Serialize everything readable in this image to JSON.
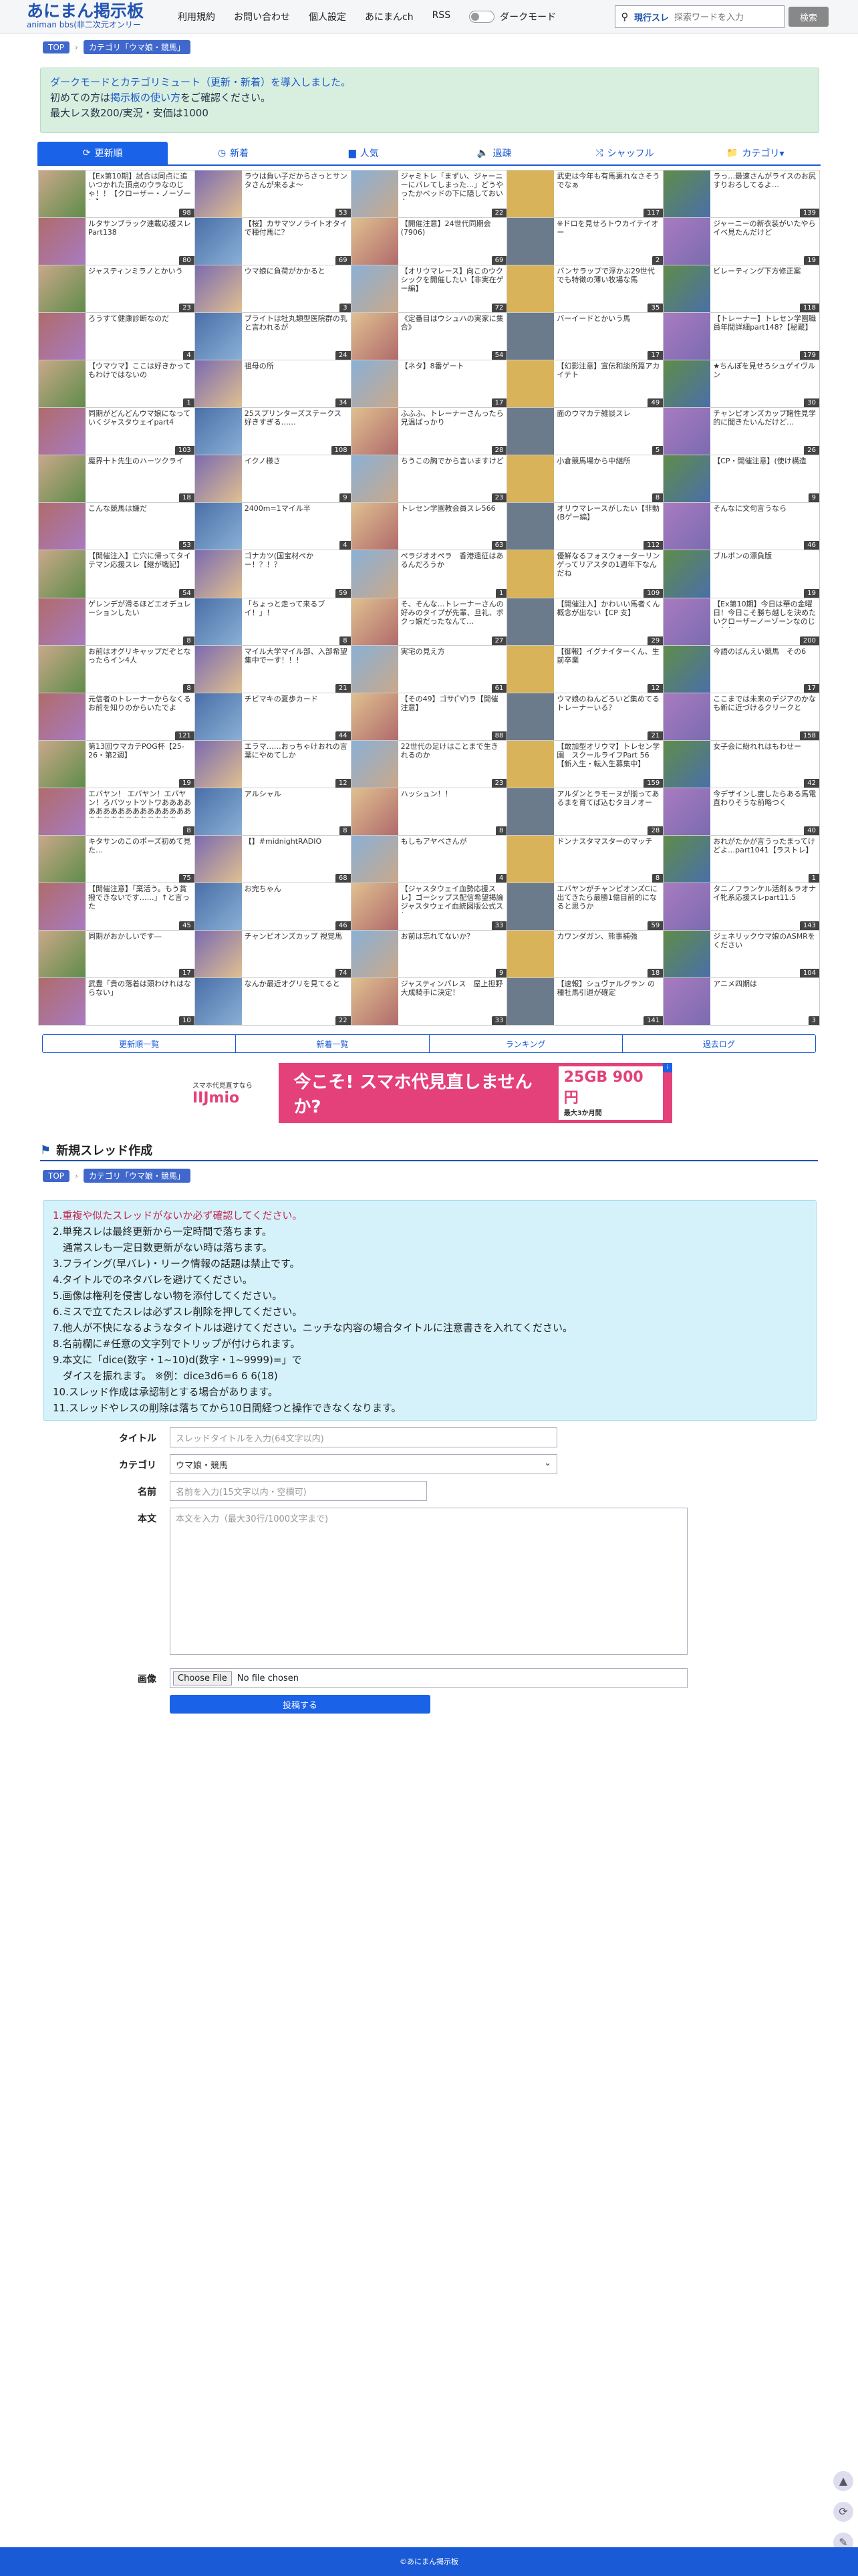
{
  "header": {
    "logo_main": "あにまん掲示板",
    "logo_sub": "animan bbs(非二次元オンリー",
    "nav": [
      "利用規約",
      "お問い合わせ",
      "個人設定",
      "あにまんch",
      "RSS"
    ],
    "dark_mode_label": "ダークモード",
    "search_kind": "現行スレ",
    "search_placeholder": "探索ワードを入力",
    "search_button": "検索"
  },
  "breadcrumb": {
    "top": "TOP",
    "category": "カテゴリ「ウマ娘・競馬」"
  },
  "notice": {
    "line1": "ダークモードとカテゴリミュート（更新・新着）を導入しました。",
    "line2_pre": "初めての方は",
    "line2_link": "掲示板の使い方",
    "line2_post": "をご確認ください。",
    "line3": "最大レス数200/実況・安価は1000"
  },
  "tabs": [
    "更新順",
    "新着",
    "人気",
    "過疎",
    "シャッフル",
    "カテゴリ▾"
  ],
  "threads": [
    {
      "title": "【Ex第10期】試合は同点に追いつかれた頂点のウラなのじゃ！！【クローザー・ノーゾーン】",
      "count": "98"
    },
    {
      "title": "ラウは負い子だからさっとサンタさんが来るよ〜",
      "count": "53"
    },
    {
      "title": "ジャミトレ「まずい、ジャーニーにバレてしまった…」どうやったかベッドの下に隠しておいた",
      "count": "22"
    },
    {
      "title": "武史は今年も有馬裏れなさそうでなぁ",
      "count": "117"
    },
    {
      "title": "ラっ…最速さんがライスのお尻すりおろしてるよ…",
      "count": "139"
    },
    {
      "title": "ルタサンブラック連載応援スレ Part138",
      "count": "80"
    },
    {
      "title": "【桜】カサマツノライトオタイで種付馬に？",
      "count": "69"
    },
    {
      "title": "【開催注意】24世代同期会(7906)",
      "count": "69"
    },
    {
      "title": "※ドロを見せろトウカイテイオー",
      "count": "2"
    },
    {
      "title": "ジャーニーの新衣装がいたやらイベ見たんだけど",
      "count": "19"
    },
    {
      "title": "ジャスティンミラノとかいう",
      "count": "23"
    },
    {
      "title": "ウマ娘に負荷がかかると",
      "count": "3"
    },
    {
      "title": "【オリウマレース】向このウクシックを開催したい【非実在ゲー編】",
      "count": "72"
    },
    {
      "title": "バンサラップで浮かぶ29世代でも特徴の薄い牧場な馬",
      "count": "35"
    },
    {
      "title": "ビレーティング下方修正案",
      "count": "118"
    },
    {
      "title": "ろうすて健康診断なのだ",
      "count": "4"
    },
    {
      "title": "ブライトは牡丸類型医院群の乳と言われるが",
      "count": "24"
    },
    {
      "title": "《定番目はウシュハの実家に集合》",
      "count": "54"
    },
    {
      "title": "バーイードとかいう馬",
      "count": "17"
    },
    {
      "title": "【トレーナー】トレセン学園職員年間詳細part148?【秘蔵】",
      "count": "179"
    },
    {
      "title": "【ウマウマ】ここは好きかってもわけではないの",
      "count": "1"
    },
    {
      "title": "祖母の所",
      "count": "34"
    },
    {
      "title": "【ネタ】8番ゲート",
      "count": "17"
    },
    {
      "title": "【幻影注意】宣伝和談所篇アカイテト",
      "count": "49"
    },
    {
      "title": "★ちんぽを見せろシュゲイヴルン",
      "count": "30"
    },
    {
      "title": "同期がどんどんウマ娘になっていくジャスタウェイpart4",
      "count": "103"
    },
    {
      "title": "25スプリンターズステークス好きすぎる……",
      "count": "108"
    },
    {
      "title": "ふふふ、トレーナーさんったら兄温ばっかり",
      "count": "28"
    },
    {
      "title": "面のウマカテ雑談スレ",
      "count": "5"
    },
    {
      "title": "チャンピオンズカップ賭性見学的に聞きたいんだけど…",
      "count": "26"
    },
    {
      "title": "魔界十ト先生のハーツクライ",
      "count": "18"
    },
    {
      "title": "イクノ様さ",
      "count": "9"
    },
    {
      "title": "ちうこの胸でから言いますけど",
      "count": "23"
    },
    {
      "title": "小倉競馬場から中継所",
      "count": "8"
    },
    {
      "title": "【CP・開催注意】(使け構造",
      "count": "9"
    },
    {
      "title": "こんな競馬は嫌だ",
      "count": "53"
    },
    {
      "title": "2400m=1マイル半",
      "count": "4"
    },
    {
      "title": "トレセン学園教会員スレ566",
      "count": "63"
    },
    {
      "title": "オリウマレースがしたい【非動(Bゲー編】",
      "count": "112"
    },
    {
      "title": "そんなに文句言うなら",
      "count": "46"
    },
    {
      "title": "【開催注入】亡穴に帰ってタイテマン応援スレ【継が戦記】",
      "count": "54"
    },
    {
      "title": "ゴナカツ(国宝材ぺかー！？！？",
      "count": "59"
    },
    {
      "title": "ペラジオオペラ　香港遠征はあるんだろうか",
      "count": "1"
    },
    {
      "title": "優鮮なるフォスウォーターリンゲってリアスタの1週年下なんだね",
      "count": "109"
    },
    {
      "title": "ブルボンの漂負版",
      "count": "19"
    },
    {
      "title": "ゲレンデが滑るほどエオデュレーションしたい",
      "count": "8"
    },
    {
      "title": "「ちょっと走って来るブイ！」！",
      "count": "8"
    },
    {
      "title": "そ、そんな…トレーナーさんの好みのタイプが先輩、旦礼、ボクっ娘だったなんて…",
      "count": "27"
    },
    {
      "title": "【開催注入】かわいい馬者くん概念が出ない【CP 支】",
      "count": "29"
    },
    {
      "title": "【Ex第10期】今日は華の金曜日！今日こそ勝ち越しを決めたいクローザーノーゾーンなのじゃ！！",
      "count": "200"
    },
    {
      "title": "お前はオグリキャップだぞとなったらイン4人",
      "count": "8"
    },
    {
      "title": "マイル大学マイル部、入部希望集中で一す！！！",
      "count": "21"
    },
    {
      "title": "実宅の見え方",
      "count": "61"
    },
    {
      "title": "【御報】イグナイターくん、生前卒業",
      "count": "12"
    },
    {
      "title": "今語のばんえい競馬　その6",
      "count": "17"
    },
    {
      "title": "元信者のトレーナーからなくるお前を知りのからいたでよ",
      "count": "121"
    },
    {
      "title": "チビマキの夏歩カード",
      "count": "44"
    },
    {
      "title": "【その49】ゴサ( ゚∀゚)ラ【開催注意】",
      "count": "88"
    },
    {
      "title": "ウマ娘のねんどろいど集めてるトレーナーいる？",
      "count": "21"
    },
    {
      "title": "ここまでは未来のデジアのかなも新に近づけるクリークと",
      "count": "158"
    },
    {
      "title": "第13回ウマカテPOG杯【25-26・第2週】",
      "count": "19"
    },
    {
      "title": "エラマ……おっちゃけおれの言葉にやめてしか",
      "count": "12"
    },
    {
      "title": "22世代の足けはことまで生きれるのか",
      "count": "23"
    },
    {
      "title": "【敢加型オリウマ】トレセン学園　スクールライフPart 56【新入生・転入生募集中】",
      "count": "159"
    },
    {
      "title": "女子会に紛れれはもわせー",
      "count": "42"
    },
    {
      "title": "エバヤン！ エバヤン！エバヤン！ろバツットツトワあああああああああああああああああああああああああああああああ！！！",
      "count": "8"
    },
    {
      "title": "アルシャル",
      "count": "8"
    },
    {
      "title": "ハッシュン！！",
      "count": "8"
    },
    {
      "title": "アルダンとラモーヌが揃ってあるまを育てば込むタヨノオー",
      "count": "28"
    },
    {
      "title": "今デザインし度したらある馬電直わりそうな前略つく",
      "count": "40"
    },
    {
      "title": "キタサンのこのポーズ初めて見た…",
      "count": "75"
    },
    {
      "title": "【】#midnightRADIO",
      "count": "68"
    },
    {
      "title": "もしもアヤベさんが",
      "count": "4"
    },
    {
      "title": "ドンナスタマスターのマッチ",
      "count": "8"
    },
    {
      "title": "おれがたかが言うったまってけどよ…part1041【ラストレ】",
      "count": "1"
    },
    {
      "title": "【開催注意】「棄活う。もう賞撥できないです……」↑と言った",
      "count": "45"
    },
    {
      "title": "お完ちゃん",
      "count": "46"
    },
    {
      "title": "【ジャスタウェイ血勢応援スレ】ゴーシップス配信希望掲論ジャスタウェイ血統図版公式スレ",
      "count": "33"
    },
    {
      "title": "エバヤンがチャンピオンズCに出てきたら最勝1億目前的になると思うか",
      "count": "59"
    },
    {
      "title": "タニノフランケル活剤＆ラオナイ牝系応援スレpart11.5",
      "count": "143"
    },
    {
      "title": "同期がおかしいです―",
      "count": "17"
    },
    {
      "title": "チャンピオンズカップ 視覚馬",
      "count": "74"
    },
    {
      "title": "お前は忘れてないか？",
      "count": "9"
    },
    {
      "title": "カワンダガン、熊事補強",
      "count": "18"
    },
    {
      "title": "ジェネリックウマ娘のASMRをください",
      "count": "104"
    },
    {
      "title": "武豊「貴の落着は頭わけれはならない」",
      "count": "10"
    },
    {
      "title": "なんか最近オグリを見てると",
      "count": "22"
    },
    {
      "title": "ジャスティンパレス　屋上担野大成騎手に決定！",
      "count": "33"
    },
    {
      "title": "【速報】シュヴァルグラン の種牡馬引退が確定",
      "count": "141"
    },
    {
      "title": "アニメ四期は",
      "count": "3"
    }
  ],
  "bottom_nav": [
    "更新順一覧",
    "新着一覧",
    "ランキング",
    "過去ログ"
  ],
  "ad": {
    "small": "スマホ代見直すなら",
    "brand": "IIJmio",
    "headline": "今こそ! スマホ代見直しませんか?",
    "offer": "25GB 900円",
    "offer_note": "最大3か月間"
  },
  "new_thread": {
    "heading": "新規スレッド作成"
  },
  "rules": [
    "1.重複や似たスレッドがないか必ず確認してください。",
    "2.単発スレは最終更新から一定時間で落ちます。",
    "　通常スレも一定日数更新がない時は落ちます。",
    "3.フライング(早バレ)・リーク情報の話題は禁止です。",
    "4.タイトルでのネタバレを避けてください。",
    "5.画像は権利を侵害しない物を添付してください。",
    "6.ミスで立てたスレは必ずスレ削除を押してください。",
    "7.他人が不快になるようなタイトルは避けてください。ニッチな内容の場合タイトルに注意書きを入れてください。",
    "8.名前欄に#任意の文字列でトリップが付けられます。",
    "9.本文に「dice(数字・1~10)d(数字・1~9999)=」で",
    "　ダイスを振れます。 ※例：dice3d6=6 6 6(18)",
    "10.スレッド作成は承認制とする場合があります。",
    "11.スレッドやレスの削除は落ちてから10日間経つと操作できなくなります。"
  ],
  "form": {
    "title_label": "タイトル",
    "title_placeholder": "スレッドタイトルを入力(64文字以内)",
    "category_label": "カテゴリ",
    "category_value": "ウマ娘・競馬",
    "name_label": "名前",
    "name_placeholder": "名前を入力(15文字以内・空欄可)",
    "body_label": "本文",
    "body_placeholder": "本文を入力（最大30行/1000文字まで)",
    "image_label": "画像",
    "file_button": "Choose File",
    "file_status": "No file chosen",
    "submit": "投稿する"
  },
  "footer": "©あにまん掲示板"
}
